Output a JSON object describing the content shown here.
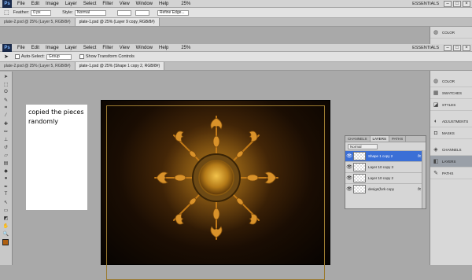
{
  "app": {
    "logo": "Ps"
  },
  "menu1": [
    "File",
    "Edit",
    "Image",
    "Layer",
    "Select",
    "Filter",
    "View",
    "Window",
    "Help"
  ],
  "zoom1": "25%",
  "workspace1": "ESSENTIALS",
  "options1": {
    "feather_label": "Feather:",
    "feather_value": "0 px",
    "style_label": "Style:",
    "style_value": "Normal",
    "refine_label": "Refine Edge..."
  },
  "tabs1": [
    "plate-2.psd @ 25% (Layer 5, RGB/8#)",
    "plate-1.psd @ 25% (Layer 9 copy, RGB/8#)"
  ],
  "menu2": [
    "File",
    "Edit",
    "Image",
    "Layer",
    "Select",
    "Filter",
    "View",
    "Window",
    "Help"
  ],
  "zoom2": "25%",
  "workspace2": "ESSENTIALS",
  "options2": {
    "autoselect_label": "Auto-Select:",
    "autoselect_value": "Group",
    "transform_label": "Show Transform Controls"
  },
  "tabs2": [
    "plate-2.psd @ 25% (Layer 5, RGB/8#)",
    "plate-1.psd @ 25% (Shape 1 copy 2, RGB/8#)"
  ],
  "note": {
    "text": "copied the pieces randomly"
  },
  "panels_top": [
    "COLOR"
  ],
  "panels": [
    "COLOR",
    "SWATCHES",
    "STYLES",
    "ADJUSTMENTS",
    "MASKS",
    "CHANNELS",
    "LAYERS",
    "PATHS"
  ],
  "layers_panel": {
    "tabs": [
      "CHANNELS",
      "LAYERS",
      "PATHS"
    ],
    "blend_mode": "Normal",
    "rows": [
      {
        "name": "Shape 1 copy 2",
        "fx": "fx"
      },
      {
        "name": "Layer 10 copy 3",
        "fx": ""
      },
      {
        "name": "Layer 10 copy 2",
        "fx": ""
      },
      {
        "name": "design(fork copy",
        "fx": "fx"
      }
    ]
  },
  "colors": {
    "accent": "#3b6fd6",
    "foreground": "#b06010"
  }
}
